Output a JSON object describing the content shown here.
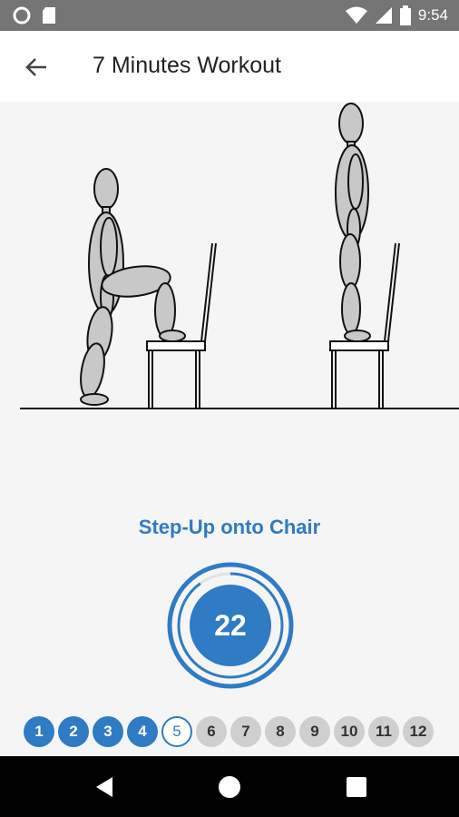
{
  "status": {
    "time": "9:54"
  },
  "app_bar": {
    "title": "7 Minutes Workout"
  },
  "exercise": {
    "name": "Step-Up onto Chair",
    "timer": "22",
    "timer_progress": 0.9
  },
  "progress": {
    "steps": [
      "1",
      "2",
      "3",
      "4",
      "5",
      "6",
      "7",
      "8",
      "9",
      "10",
      "11",
      "12"
    ],
    "completed_count": 4,
    "current_index": 4
  },
  "colors": {
    "accent": "#2f7bc4",
    "status_bar": "#757575",
    "inactive_step": "#cfcfcf"
  },
  "icons": {
    "back": "arrow-back-icon",
    "nav_back": "triangle-back-icon",
    "nav_home": "circle-home-icon",
    "nav_recents": "square-recents-icon"
  }
}
